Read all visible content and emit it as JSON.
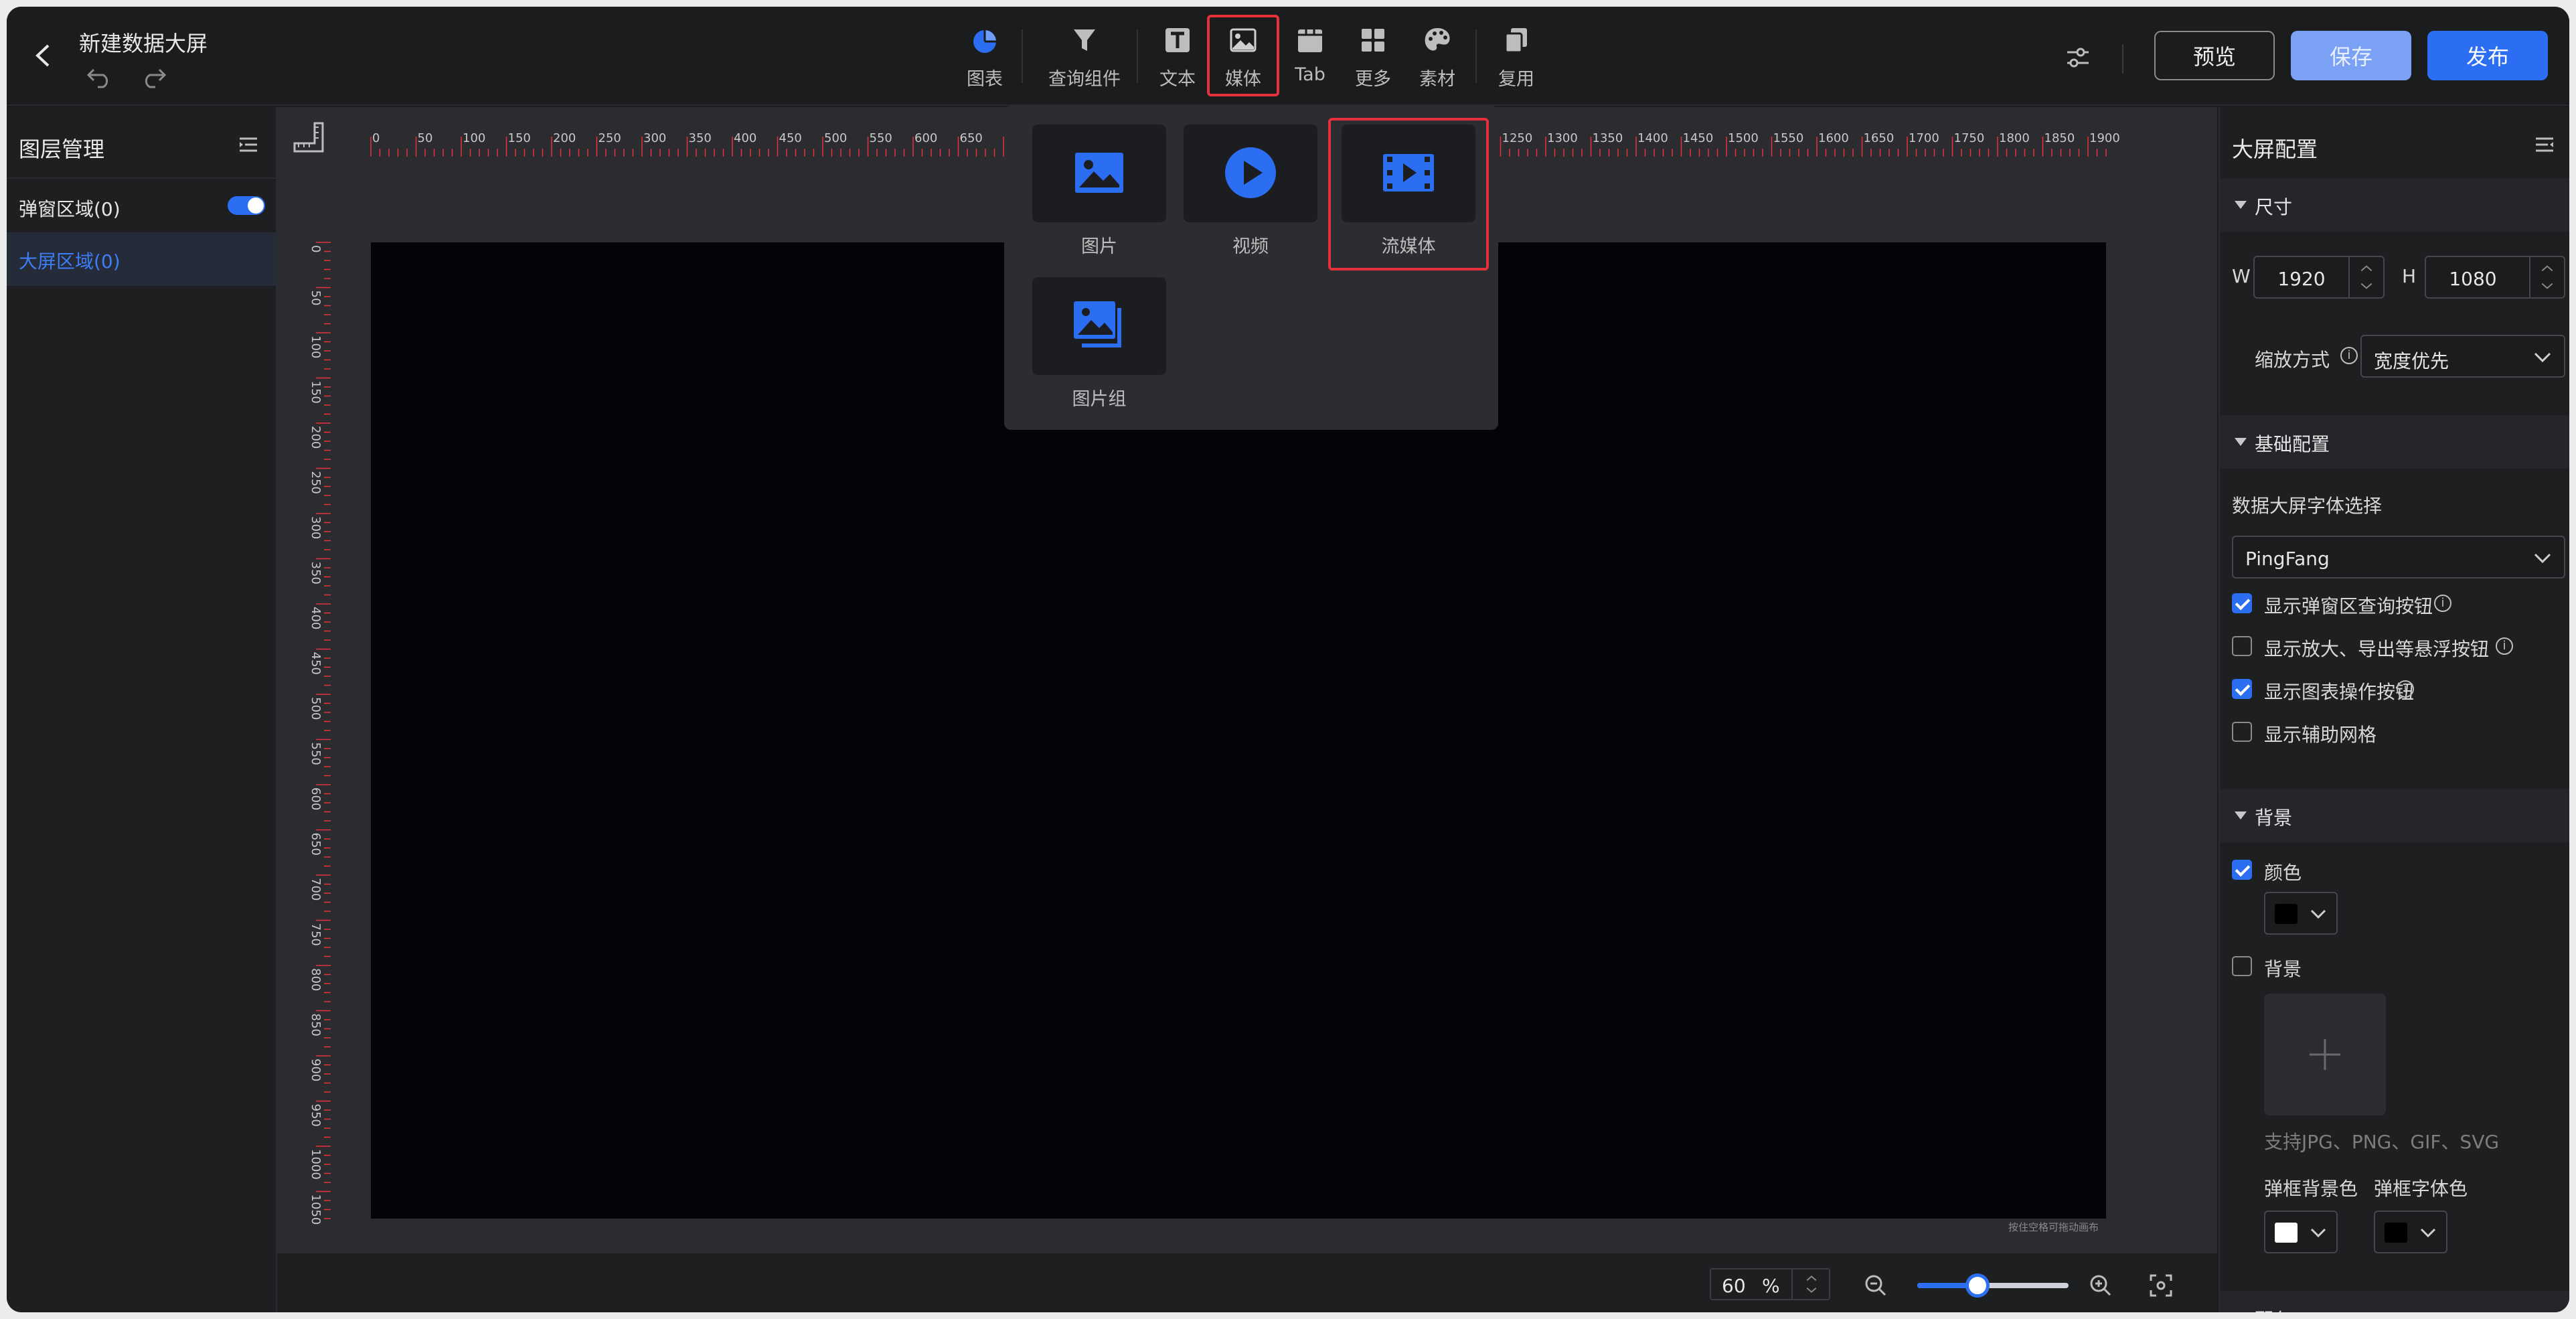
{
  "header": {
    "title": "新建数据大屏",
    "tools": [
      {
        "label": "图表",
        "icon": "chart-icon"
      },
      {
        "label": "查询组件",
        "icon": "filter-icon"
      },
      {
        "label": "文本",
        "icon": "text-icon"
      },
      {
        "label": "媒体",
        "icon": "media-icon"
      },
      {
        "label": "Tab",
        "icon": "tab-icon"
      },
      {
        "label": "更多",
        "icon": "grid-icon"
      },
      {
        "label": "素材",
        "icon": "palette-icon"
      },
      {
        "label": "复用",
        "icon": "copy-icon"
      }
    ],
    "buttons": {
      "preview": "预览",
      "save": "保存",
      "publish": "发布"
    }
  },
  "left_panel": {
    "title": "图层管理",
    "popup_area": "弹窗区域(0)",
    "screen_area": "大屏区域(0)"
  },
  "media_menu": {
    "items": [
      {
        "label": "图片",
        "icon": "image-icon"
      },
      {
        "label": "视频",
        "icon": "video-icon"
      },
      {
        "label": "流媒体",
        "icon": "stream-media-icon"
      },
      {
        "label": "图片组",
        "icon": "image-group-icon"
      }
    ]
  },
  "canvas": {
    "h_ruler_labels": [
      "0",
      "50",
      "100",
      "150",
      "200",
      "250",
      "300",
      "350",
      "400",
      "450",
      "500",
      "550",
      "600",
      "650",
      "1250",
      "1300",
      "1350",
      "1400",
      "1450",
      "1500",
      "1550",
      "1600",
      "1650",
      "1700",
      "1750",
      "1800",
      "1850",
      "1900"
    ],
    "v_ruler_labels": [
      "0",
      "50",
      "100",
      "150",
      "200",
      "250",
      "300",
      "350",
      "400",
      "450",
      "500",
      "550",
      "600",
      "650",
      "700",
      "750",
      "800",
      "850",
      "900",
      "950",
      "1000",
      "1050"
    ],
    "drag_hint": "按住空格可拖动画布",
    "zoom_value": "60",
    "zoom_unit": "%",
    "zoom_level": 0.4
  },
  "right_panel": {
    "title": "大屏配置",
    "size_section": "尺寸",
    "w_label": "W",
    "w_value": "1920",
    "h_label": "H",
    "h_value": "1080",
    "scale_label": "缩放方式",
    "scale_value": "宽度优先",
    "basic_section": "基础配置",
    "font_label": "数据大屏字体选择",
    "font_value": "PingFang",
    "checks": [
      {
        "label": "显示弹窗区查询按钮",
        "checked": true
      },
      {
        "label": "显示放大、导出等悬浮按钮",
        "checked": false
      },
      {
        "label": "显示图表操作按钮",
        "checked": true
      },
      {
        "label": "显示辅助网格",
        "checked": false
      }
    ],
    "bg_section": "背景",
    "color_label": "颜色",
    "color_checked": true,
    "bg_label": "背景",
    "bg_checked": false,
    "upload_hint": "支持JPG、PNG、GIF、SVG",
    "popup_bg_color_label": "弹框背景色",
    "popup_font_color_label": "弹框字体色",
    "next_section": "配色"
  },
  "colors": {
    "accent": "#2c6ef2",
    "highlight": "#e5313c",
    "canvas_bg": "#030407",
    "color_swatch": "#000000",
    "popup_bg_swatch": "#ffffff",
    "popup_font_swatch": "#000000"
  }
}
